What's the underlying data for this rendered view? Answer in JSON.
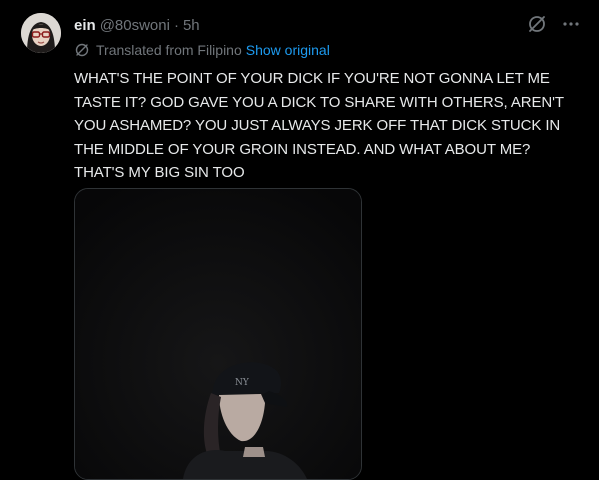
{
  "post": {
    "author": {
      "display_name": "ein",
      "handle": "@80swoni"
    },
    "separator": "·",
    "timestamp": "5h",
    "translation": {
      "label": "Translated from Filipino",
      "link": "Show original"
    },
    "text": "WHAT'S THE POINT OF YOUR DICK IF YOU'RE NOT GONNA LET ME TASTE IT? GOD GAVE YOU A DICK TO SHARE WITH OTHERS, AREN'T YOU ASHAMED? YOU JUST ALWAYS JERK OFF THAT DICK STUCK IN THE MIDDLE OF YOUR GROIN INSTEAD. AND WHAT ABOUT ME? THAT'S MY BIG SIN TOO",
    "icons": {
      "grok": "grok-slash-icon",
      "more": "more-horizontal-icon",
      "translate": "translate-icon"
    }
  },
  "colors": {
    "background": "#000000",
    "text_primary": "#e7e9ea",
    "text_secondary": "#71767b",
    "link": "#1d9bf0",
    "border": "#2f3336"
  }
}
